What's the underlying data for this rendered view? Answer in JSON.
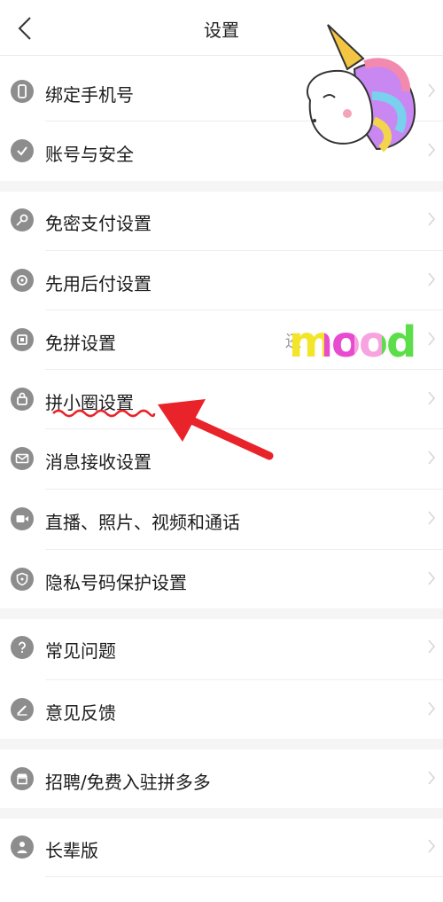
{
  "header": {
    "title": "设置",
    "back_icon": "chevron-left-icon"
  },
  "items": [
    {
      "label": "绑定手机号",
      "icon": "phone-icon"
    },
    {
      "label": "账号与安全",
      "icon": "shield-icon"
    },
    {
      "label": "免密支付设置",
      "icon": "key-icon"
    },
    {
      "label": "先用后付设置",
      "icon": "badge-icon"
    },
    {
      "label": "免拼设置",
      "icon": "group-card-icon",
      "extra": "还"
    },
    {
      "label": "拼小圈设置",
      "icon": "lock-bag-icon"
    },
    {
      "label": "消息接收设置",
      "icon": "envelope-icon"
    },
    {
      "label": "直播、照片、视频和通话",
      "icon": "video-camera-icon"
    },
    {
      "label": "隐私号码保护设置",
      "icon": "privacy-shield-icon"
    },
    {
      "label": "常见问题",
      "icon": "question-icon"
    },
    {
      "label": "意见反馈",
      "icon": "pencil-icon"
    },
    {
      "label": "招聘/免费入驻拼多多",
      "icon": "store-icon"
    },
    {
      "label": "长辈版",
      "icon": "person-icon"
    }
  ],
  "stickers": {
    "mood_text": "mood"
  },
  "colors": {
    "icon": "#8d8d8d",
    "arrow": "#e8232a",
    "underline": "#e8232a"
  }
}
